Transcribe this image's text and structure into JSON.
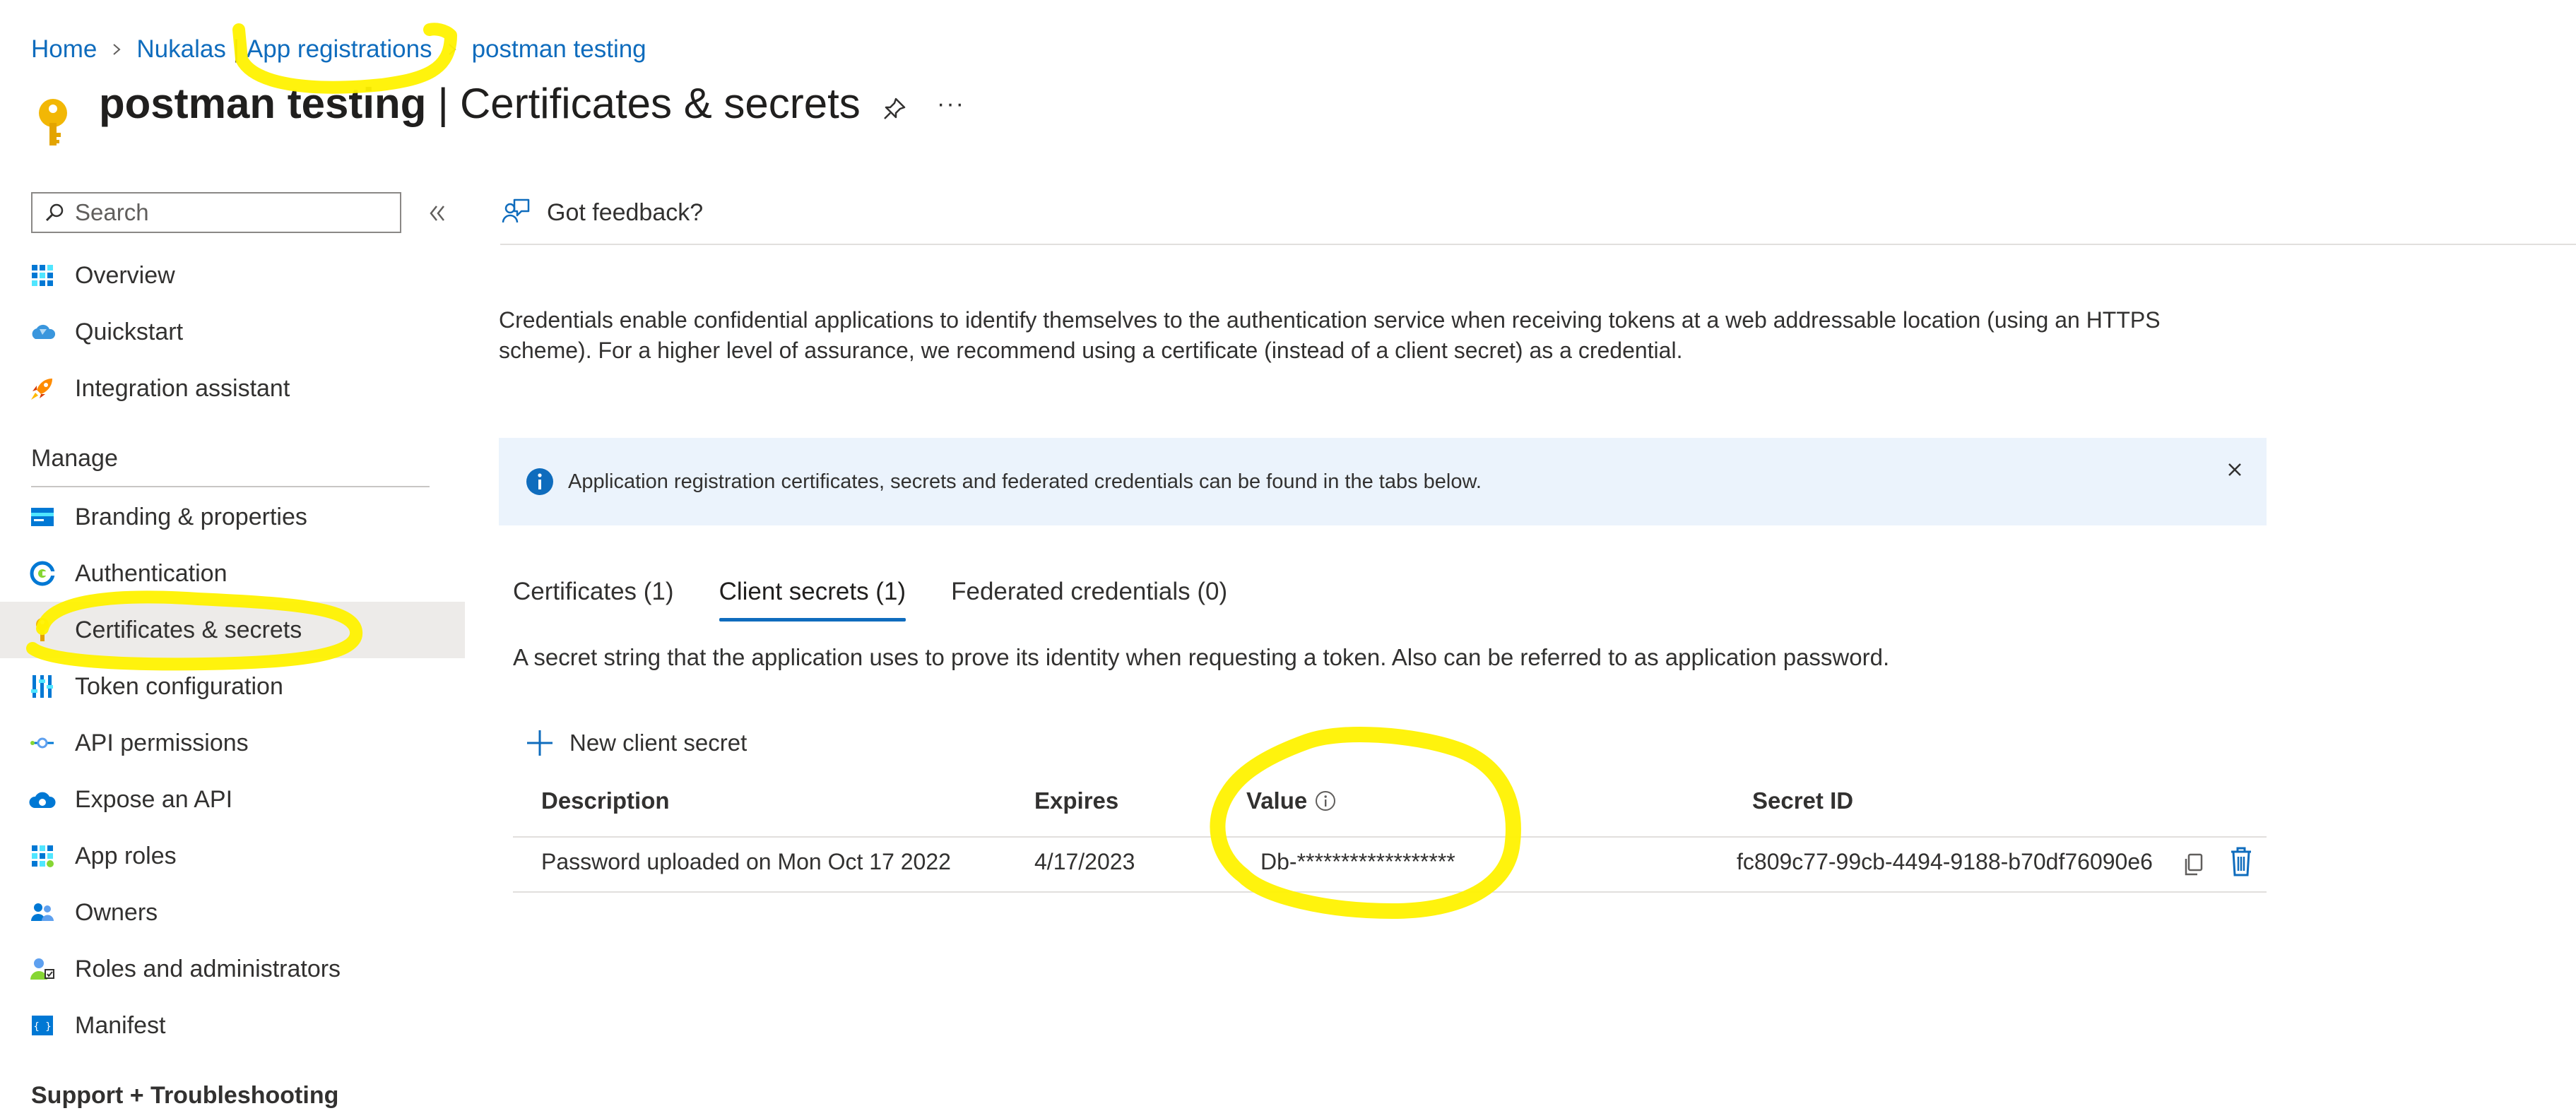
{
  "breadcrumb": {
    "items": [
      "Home",
      "Nukalas",
      "App registrations",
      "postman testing"
    ],
    "separator_after_nukalas": "|"
  },
  "header": {
    "title_app": "postman testing",
    "title_divider": "|",
    "title_page": "Certificates & secrets",
    "pin_icon": "pin-icon",
    "more_label": "···"
  },
  "sidebar": {
    "search_placeholder": "Search",
    "top_items": [
      {
        "label": "Overview",
        "icon": "overview-icon"
      },
      {
        "label": "Quickstart",
        "icon": "quickstart-icon"
      },
      {
        "label": "Integration assistant",
        "icon": "rocket-icon"
      }
    ],
    "manage_heading": "Manage",
    "manage_items": [
      {
        "label": "Branding & properties",
        "icon": "branding-icon"
      },
      {
        "label": "Authentication",
        "icon": "authentication-icon"
      },
      {
        "label": "Certificates & secrets",
        "icon": "key-icon",
        "selected": true
      },
      {
        "label": "Token configuration",
        "icon": "token-icon"
      },
      {
        "label": "API permissions",
        "icon": "api-permissions-icon"
      },
      {
        "label": "Expose an API",
        "icon": "cloud-icon"
      },
      {
        "label": "App roles",
        "icon": "app-roles-icon"
      },
      {
        "label": "Owners",
        "icon": "owners-icon"
      },
      {
        "label": "Roles and administrators",
        "icon": "roles-icon"
      },
      {
        "label": "Manifest",
        "icon": "manifest-icon"
      }
    ],
    "support_heading": "Support + Troubleshooting"
  },
  "toolbar": {
    "feedback_label": "Got feedback?"
  },
  "main": {
    "description": "Credentials enable confidential applications to identify themselves to the authentication service when receiving tokens at a web addressable location (using an HTTPS scheme). For a higher level of assurance, we recommend using a certificate (instead of a client secret) as a credential.",
    "info_message": "Application registration certificates, secrets and federated credentials can be found in the tabs below.",
    "tabs": [
      {
        "label": "Certificates (1)",
        "active": false
      },
      {
        "label": "Client secrets (1)",
        "active": true
      },
      {
        "label": "Federated credentials (0)",
        "active": false
      }
    ],
    "tab_description": "A secret string that the application uses to prove its identity when requesting a token. Also can be referred to as application password.",
    "new_secret_label": "New client secret",
    "table": {
      "columns": [
        "Description",
        "Expires",
        "Value",
        "Secret ID"
      ],
      "rows": [
        {
          "description": "Password uploaded on Mon Oct 17 2022",
          "expires": "4/17/2023",
          "value": "Db-******************",
          "secret_id": "fc809c77-99cb-4494-9188-b70df76090e6"
        }
      ]
    }
  },
  "colors": {
    "link": "#0f6cbd",
    "accent": "#0f6cbd",
    "info_bg": "#ebf3fc",
    "selected_bg": "#edebe9",
    "highlight": "#fff200"
  }
}
